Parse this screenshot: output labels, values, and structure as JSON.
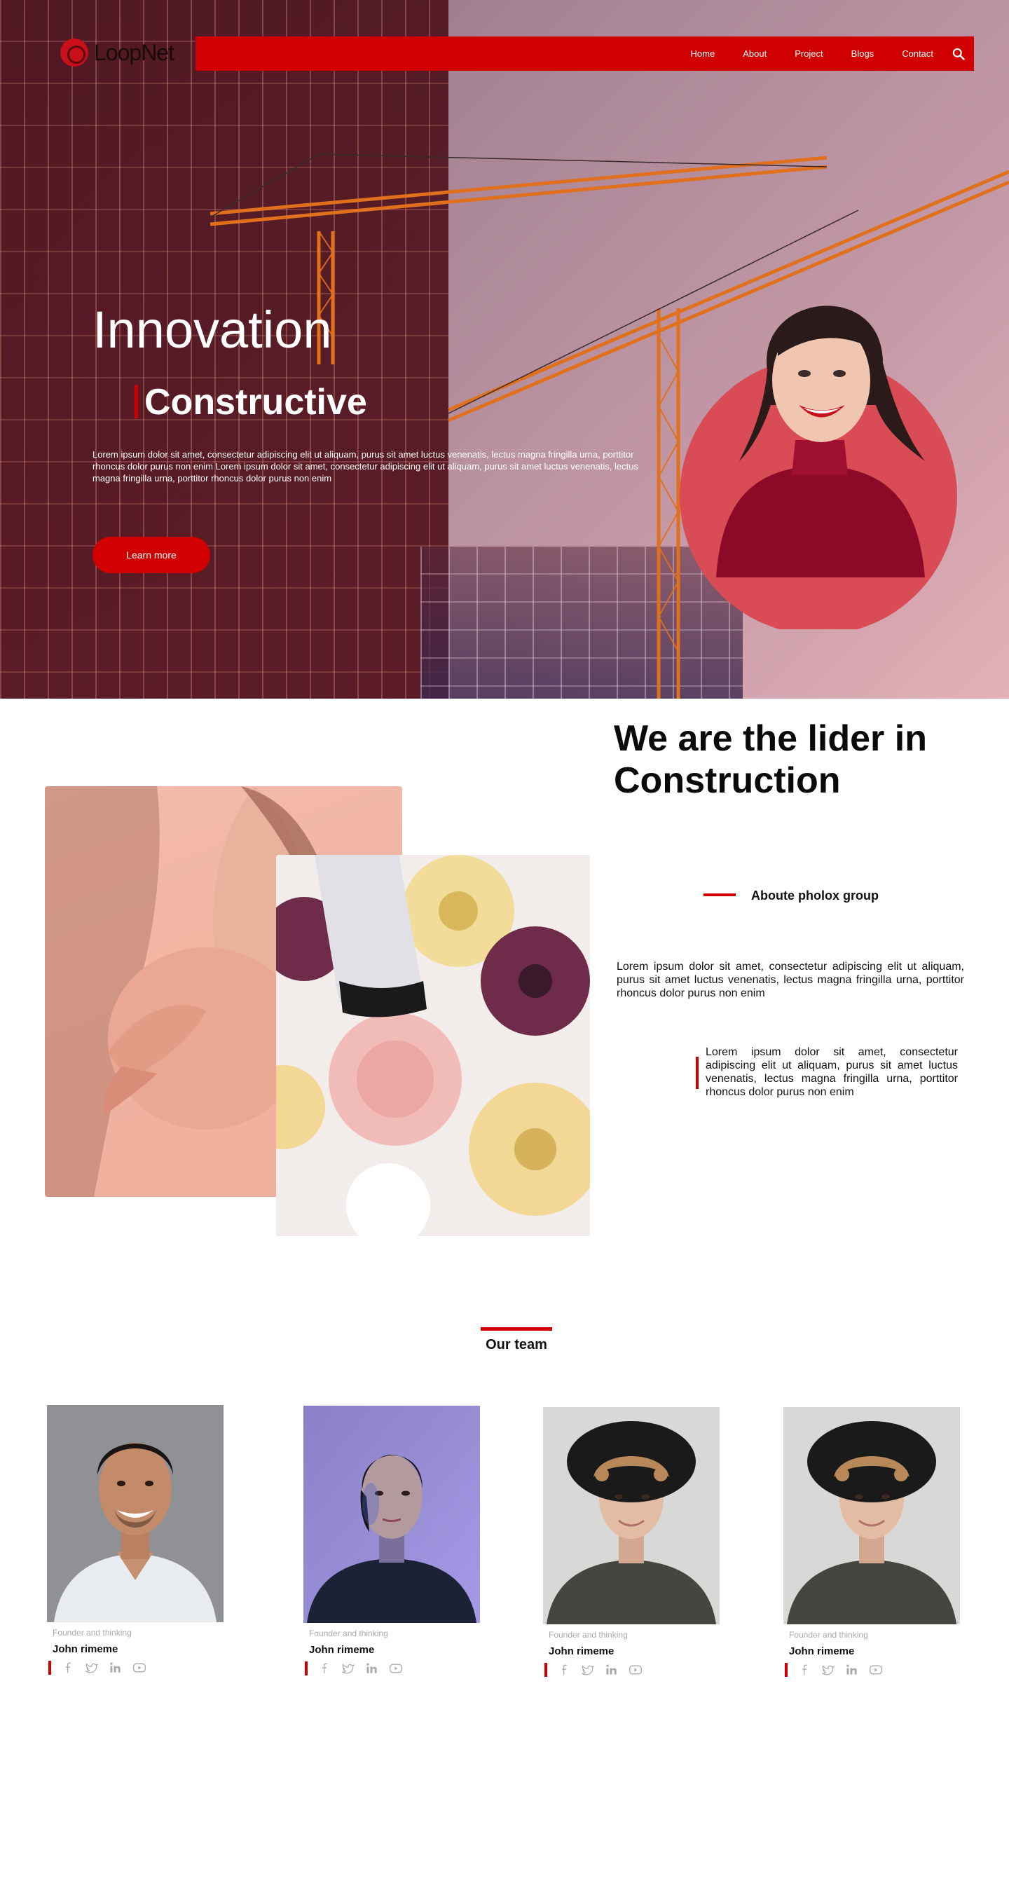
{
  "brand": {
    "logo_text": "LoopNet",
    "accent": "#d00000"
  },
  "nav": {
    "items": [
      "Home",
      "About",
      "Project",
      "Blogs",
      "Contact"
    ],
    "search_icon": "search-icon"
  },
  "hero": {
    "title": "Innovation",
    "subtitle": "Constructive",
    "body": "Lorem ipsum dolor sit amet, consectetur adipiscing elit ut aliquam, purus sit amet luctus venenatis, lectus magna fringilla urna, porttitor rhoncus dolor purus non enim Lorem ipsum dolor sit amet, consectetur adipiscing elit ut aliquam, purus sit amet luctus venenatis, lectus magna fringilla urna, porttitor rhoncus dolor purus non enim",
    "button_label": "Learn more"
  },
  "about": {
    "title": "We are the lider in Construction",
    "tag": "Aboute pholox group",
    "body": "Lorem ipsum dolor sit amet, consectetur adipiscing elit ut aliquam, purus sit amet luctus venenatis, lectus magna fringilla urna, porttitor rhoncus dolor purus non enim",
    "quote": "Lorem ipsum dolor sit amet, consectetur adipiscing elit ut aliquam, purus sit amet luctus venenatis, lectus magna fringilla urna, porttitor rhoncus dolor purus non enim"
  },
  "team": {
    "title": "Our team",
    "members": [
      {
        "role": "Founder and thinking",
        "name": "John rimeme"
      },
      {
        "role": "Founder and thinking",
        "name": "John rimeme"
      },
      {
        "role": "Founder and thinking",
        "name": "John rimeme"
      },
      {
        "role": "Founder and thinking",
        "name": "John rimeme"
      }
    ],
    "social_icons": [
      "facebook-icon",
      "twitter-icon",
      "linkedin-icon",
      "youtube-icon"
    ]
  }
}
